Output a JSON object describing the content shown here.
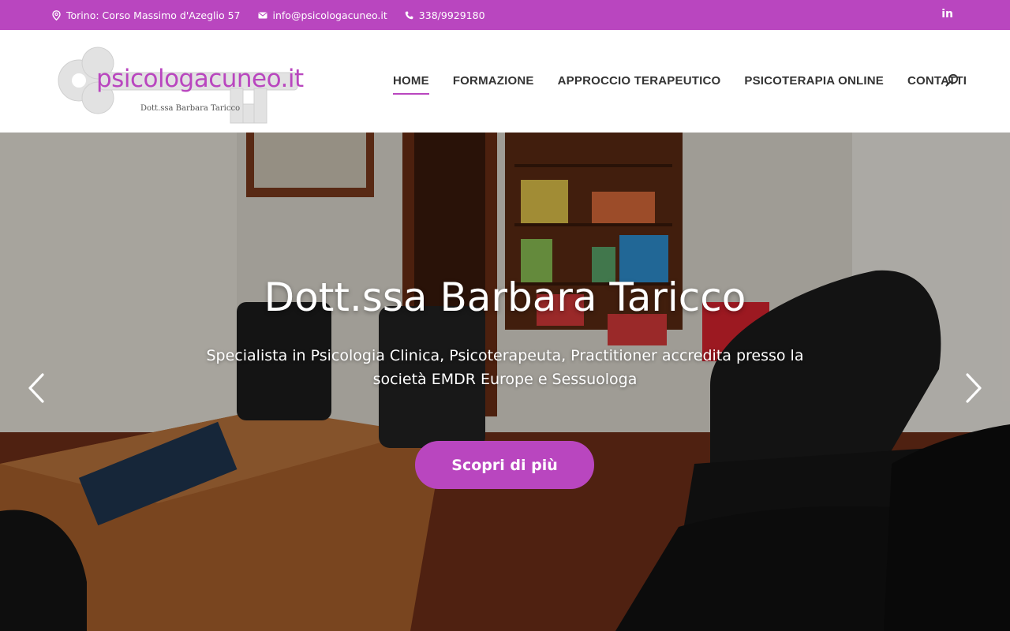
{
  "topbar": {
    "address": "Torino: Corso Massimo d'Azeglio 57",
    "email": "info@psicologacuneo.it",
    "phone": "338/9929180",
    "social_label": "in",
    "background": "#b946bf"
  },
  "logo": {
    "text": "psicologacuneo.it",
    "subtitle": "Dott.ssa Barbara Taricco",
    "accent": "#b946bf"
  },
  "nav": {
    "items": [
      {
        "label": "HOME",
        "active": true
      },
      {
        "label": "FORMAZIONE",
        "active": false
      },
      {
        "label": "APPROCCIO TERAPEUTICO",
        "active": false
      },
      {
        "label": "PSICOTERAPIA ONLINE",
        "active": false
      },
      {
        "label": "CONTATTI",
        "active": false
      }
    ],
    "search_icon": "search-icon"
  },
  "hero": {
    "title": "Dott.ssa Barbara Taricco",
    "subtitle": "Specialista in Psicologia Clinica, Psicoterapeuta, Practitioner accredita presso la società EMDR Europe e Sessuologa",
    "button_label": "Scopri di più",
    "prev_icon": "chevron-left-icon",
    "next_icon": "chevron-right-icon"
  },
  "icons": {
    "address": "map-pin-icon",
    "email": "mail-icon",
    "phone": "phone-icon",
    "social": "linkedin-icon"
  }
}
